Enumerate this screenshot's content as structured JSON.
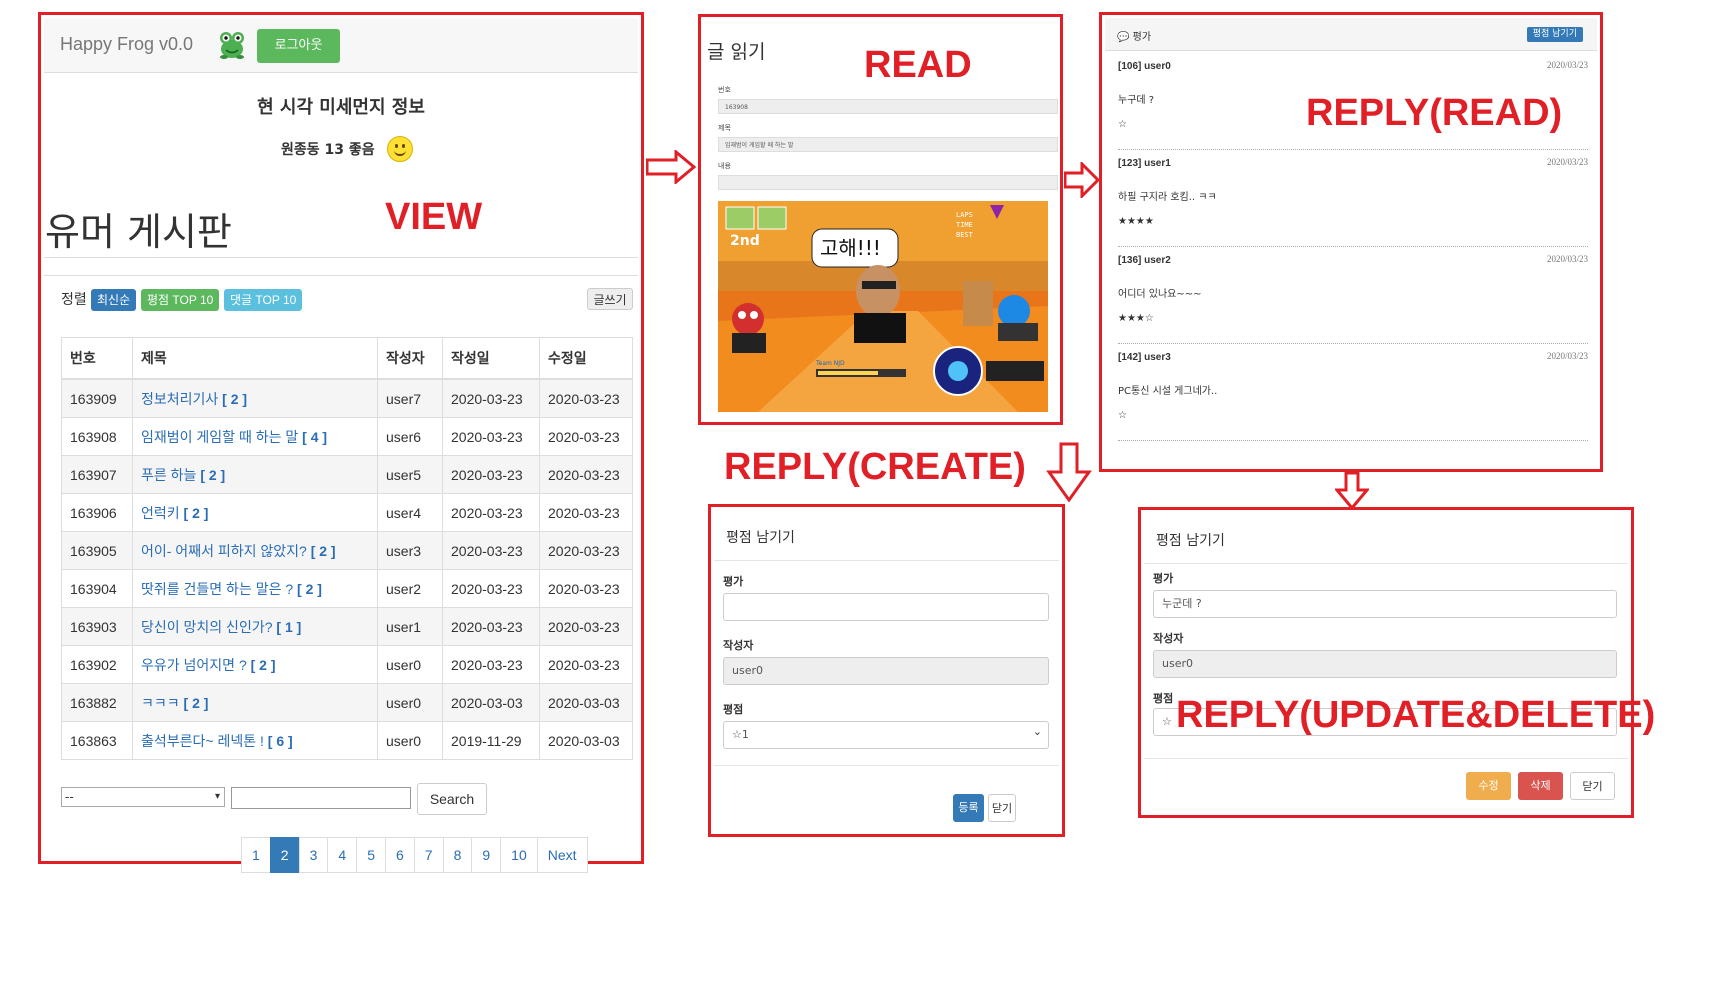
{
  "view": {
    "brand": "Happy Frog v0.0",
    "logout_label": "로그아웃",
    "dust_title": "현 시각 미세먼지 정보",
    "dust_info": "원종동 13 좋음",
    "board_title": "유머 게시판",
    "sort_label": "정렬",
    "sort_buttons": [
      "최신순",
      "평점 TOP 10",
      "댓글 TOP 10"
    ],
    "write_label": "글쓰기",
    "columns": [
      "번호",
      "제목",
      "작성자",
      "작성일",
      "수정일"
    ],
    "rows": [
      {
        "no": "163909",
        "title": "정보처리기사",
        "count": "[ 2 ]",
        "writer": "user7",
        "created": "2020-03-23",
        "updated": "2020-03-23"
      },
      {
        "no": "163908",
        "title": "임재범이 게임할 때 하는 말",
        "count": "[ 4 ]",
        "writer": "user6",
        "created": "2020-03-23",
        "updated": "2020-03-23"
      },
      {
        "no": "163907",
        "title": "푸른 하늘",
        "count": "[ 2 ]",
        "writer": "user5",
        "created": "2020-03-23",
        "updated": "2020-03-23"
      },
      {
        "no": "163906",
        "title": "언럭키",
        "count": "[ 2 ]",
        "writer": "user4",
        "created": "2020-03-23",
        "updated": "2020-03-23"
      },
      {
        "no": "163905",
        "title": "어이- 어째서 피하지 않았지?",
        "count": "[ 2 ]",
        "writer": "user3",
        "created": "2020-03-23",
        "updated": "2020-03-23"
      },
      {
        "no": "163904",
        "title": "땃쥐를 건들면 하는 말은 ?",
        "count": "[ 2 ]",
        "writer": "user2",
        "created": "2020-03-23",
        "updated": "2020-03-23"
      },
      {
        "no": "163903",
        "title": "당신이 망치의 신인가?",
        "count": "[ 1 ]",
        "writer": "user1",
        "created": "2020-03-23",
        "updated": "2020-03-23"
      },
      {
        "no": "163902",
        "title": "우유가 넘어지면 ?",
        "count": "[ 2 ]",
        "writer": "user0",
        "created": "2020-03-23",
        "updated": "2020-03-23"
      },
      {
        "no": "163882",
        "title": "ㅋㅋㅋ",
        "count": "[ 2 ]",
        "writer": "user0",
        "created": "2020-03-03",
        "updated": "2020-03-03"
      },
      {
        "no": "163863",
        "title": "출석부른다~ 레넥톤 !",
        "count": "[ 6 ]",
        "writer": "user0",
        "created": "2019-11-29",
        "updated": "2020-03-03"
      }
    ],
    "search_select": "--",
    "search_label": "Search",
    "pages": [
      "1",
      "2",
      "3",
      "4",
      "5",
      "6",
      "7",
      "8",
      "9",
      "10",
      "Next"
    ],
    "active_page": "2"
  },
  "read": {
    "title": "글 읽기",
    "speech": "고해!!!",
    "hud_laps": "LAPS",
    "hud_time": "TIME",
    "hud_best": "BEST",
    "hud_rank": "2nd",
    "hud_team": "Team NJD"
  },
  "reply_read": {
    "header": "평가",
    "rate_button": "평점 남기기",
    "items": [
      {
        "who": "[106] user0",
        "date": "2020/03/23",
        "msg": "누구데 ?",
        "stars": "☆"
      },
      {
        "who": "[123] user1",
        "date": "2020/03/23",
        "msg": "하필 구지라 호킴.. ㅋㅋ",
        "stars": "★★★★"
      },
      {
        "who": "[136] user2",
        "date": "2020/03/23",
        "msg": "어디더 있나요~~~",
        "stars": "★★★☆"
      },
      {
        "who": "[142] user3",
        "date": "2020/03/23",
        "msg": "PC통신 시설 게그네가..",
        "stars": "☆"
      }
    ]
  },
  "reply_create": {
    "title": "평점 남기기",
    "eval_label": "평가",
    "writer_label": "작성자",
    "writer_value": "user0",
    "score_label": "평점",
    "score_value": "☆1",
    "submit": "등록",
    "close": "닫기"
  },
  "reply_update": {
    "title": "평점 남기기",
    "eval_label": "평가",
    "eval_value": "누군데 ?",
    "writer_label": "작성자",
    "writer_value": "user0",
    "score_label": "평점",
    "score_value": "☆",
    "edit": "수정",
    "delete": "삭제",
    "close": "닫기"
  },
  "tags": {
    "view": "VIEW",
    "read": "READ",
    "reply_read": "REPLY(READ)",
    "reply_create": "REPLY(CREATE)",
    "reply_update": "REPLY(UPDATE&DELETE)"
  },
  "colors": {
    "frame": "#e01f26",
    "success": "#5cb85c",
    "primary": "#337ab7",
    "info": "#5bc0de",
    "warning": "#f0ad4e",
    "danger": "#d9534f"
  }
}
